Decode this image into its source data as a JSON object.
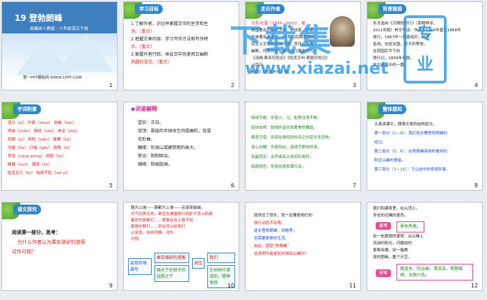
{
  "slides": [
    {
      "number": "1",
      "title": "19 登勃朗峰",
      "subtitle": "部编本人教版 · 八年级语文下册",
      "footer": "第一PPT模板网-WWW.1PPT.COM"
    },
    {
      "number": "2",
      "tag": "学习目标",
      "lines": [
        "1.了解作者，识记并掌握文中的生字和生",
        "词。（重点）",
        "2.把握文章内容，学习写作方法和写作特",
        "点。（重点）",
        "3.掌握作者行踪，体会文中优美而又幽默",
        "风趣的语言。（重点）"
      ]
    },
    {
      "number": "3",
      "tag": "走近作者",
      "lines": [
        "马克·吐温（1835—1910），是",
        "美国著名的幽默大师、小说家、作家，",
        "也是著名演说家，19世纪后期美国现",
        "实主义文学的杰出代表，其作品风趣",
        "幽默，代表作有长篇小说《镀金时代》",
        "《汤姆·索亚历险记》《哈克贝利·费恩历险记》《百万",
        "英镑》《竞选州长》等。"
      ]
    },
    {
      "number": "4",
      "tag": "背景链接",
      "lines": [
        "本文选自《汉姆的旅行》（郭婷婷译，",
        "2011年版）林文华译。作者于1866年夏至1868年",
        "旅行，1867年一度曾经历，世界",
        "各地，包括法国、意大利等地。",
        "在回国后写下的",
        "旅行记，1869年出版。",
        "本文是其中的一篇。"
      ]
    },
    {
      "number": "5",
      "tag": "字词积累",
      "lines": [
        "望日（yì）  约瓶（zhuó）  倘嵌（kān）",
        "喷峡（chǎn） 换帐（zhǔ）  奔走（zhǒ）",
        "崆峒（jù）  斜阳（xiǎn） 雇鞭（kǎ）",
        "沟壑（hè）  打嗤（gēn）  箭弩（lú）",
        "苍穹（cāng qióng） 颜腻（liú）",
        "瞭睫（xūn）  锦骋（lín）",
        "始呈吝兀（tū）  缺憾不贴（luó yì）"
      ]
    },
    {
      "number": "6",
      "tag": "◆词语解释",
      "lines": [
        "望日：次日。",
        "穹顶：悬崖的半球体空间或曲形，穹或",
        "穹形曲。",
        "巍峨：形容山或建筑物的高大。",
        "惨淡：阴阳暗淡。",
        "嶙峋：险峻陡峭。"
      ]
    },
    {
      "number": "7",
      "lines": [
        "络绎不绝：形容人、马、船等往来不断。",
        "轻快自然：轻快的音乐和柔美的舞蹈。",
        "瞬息万变：形容在极短的时间之内变化多而快。",
        "惊心动魄：形容如此。连续不断地到来。",
        "名副其实：名声或名义和实际相符。",
        "和颜悦色：形容态度和蔼可亲。"
      ]
    },
    {
      "number": "8",
      "tag": "整体感知",
      "lines": [
        "认真读课文，理清文章的结构层次。",
        "第一部分（1—4）：我们徒步攀登勃朗峰的",
        "经过。",
        "第二部分（5、6）：在勃朗峰高地所看到的",
        "附近山峰的情景。",
        "第三部分（7—11）：下山途中的奇闻异事。"
      ]
    },
    {
      "number": "9",
      "tag": "课文探究",
      "lines": [
        "阅读第一部分，思考：",
        "为什么作者认为乘车骑驴的游客",
        "可怜可悯？"
      ]
    },
    {
      "number": "10",
      "lines": [
        "路为上坡——路都为上坡——且渐渐陡峭。",
        "天气仍然炎热，乘坐在缓慢爬行的驴子背上和骑",
        "着驴的游客们……想象在这上面不知",
        "疲倦的我们……实在可以给他们",
        "以安慰，纷纷同情，可怜",
        "可悯。"
      ],
      "compare_label": "自然环境描写",
      "center_label": "对比",
      "riders": "乘车骑驴的游客",
      "riders_desc": "强光下在辫子的挂照之下",
      "walkers": "我们",
      "walkers_desc": "在树林中漫游的，精神愉悦"
    },
    {
      "number": "11",
      "lines": [
        "既然忍了很长，就一定要使他们的",
        "旅行动而不有限。",
        "徒步登勃朗峰，领略等，",
        "但需要更美的生活。",
        "由此，感受“勃朗峰”",
        "这说明作者是如何描绘山峰的？"
      ]
    },
    {
      "number": "12",
      "lines": [
        "我们和建筑里，在山顶上，",
        "多处的远峰的景色。",
        "有一处震撼的景观：从山峰上",
        "流淌的阳光，闪耀成的",
        "景象纵横，如一幅美",
        "丽的图画，整个天空。"
      ],
      "tag_a": "总写",
      "phrase_a": "景色秀美。",
      "tag_b": "分写",
      "phrase_b": "随道关、咬谷曲、清流急，密壁峻峭、五颜六色。"
    }
  ],
  "watermark": {
    "main": "下载集",
    "url": "www.xiazai.net",
    "badge_top": "专",
    "badge_bottom": "业"
  }
}
